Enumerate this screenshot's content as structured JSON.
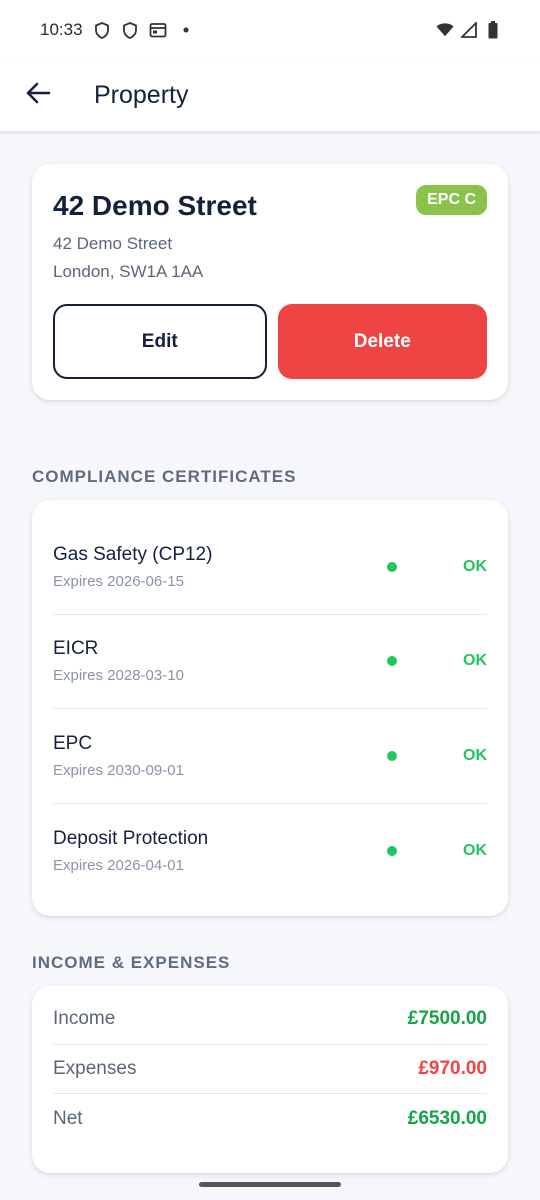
{
  "status_bar": {
    "time": "10:33",
    "icons_left": [
      "shield-icon",
      "shield-icon",
      "calendar-icon",
      "dot-icon"
    ],
    "icons_right": [
      "wifi-icon",
      "signal-icon",
      "battery-icon"
    ]
  },
  "app_bar": {
    "title": "Property",
    "back_icon": "arrow-left-icon"
  },
  "property": {
    "name": "42 Demo Street",
    "epc_badge": "EPC C",
    "address_line1": "42 Demo Street",
    "address_line2": "London, SW1A 1AA",
    "edit_label": "Edit",
    "delete_label": "Delete"
  },
  "compliance": {
    "heading": "COMPLIANCE CERTIFICATES",
    "items": [
      {
        "name": "Gas Safety (CP12)",
        "expires": "Expires 2026-06-15",
        "status": "OK"
      },
      {
        "name": "EICR",
        "expires": "Expires 2028-03-10",
        "status": "OK"
      },
      {
        "name": "EPC",
        "expires": "Expires 2030-09-01",
        "status": "OK"
      },
      {
        "name": "Deposit Protection",
        "expires": "Expires 2026-04-01",
        "status": "OK"
      }
    ]
  },
  "finance": {
    "heading": "INCOME & EXPENSES",
    "rows": [
      {
        "label": "Income",
        "value": "£7500.00"
      },
      {
        "label": "Expenses",
        "value": "£970.00"
      },
      {
        "label": "Net",
        "value": "£6530.00"
      }
    ]
  },
  "colors": {
    "primary_navy": "#14213d",
    "danger_red": "#ef4444",
    "ok_green": "#22c55e",
    "epc_badge_green": "#8bc34a",
    "background": "#f5f7fa"
  }
}
